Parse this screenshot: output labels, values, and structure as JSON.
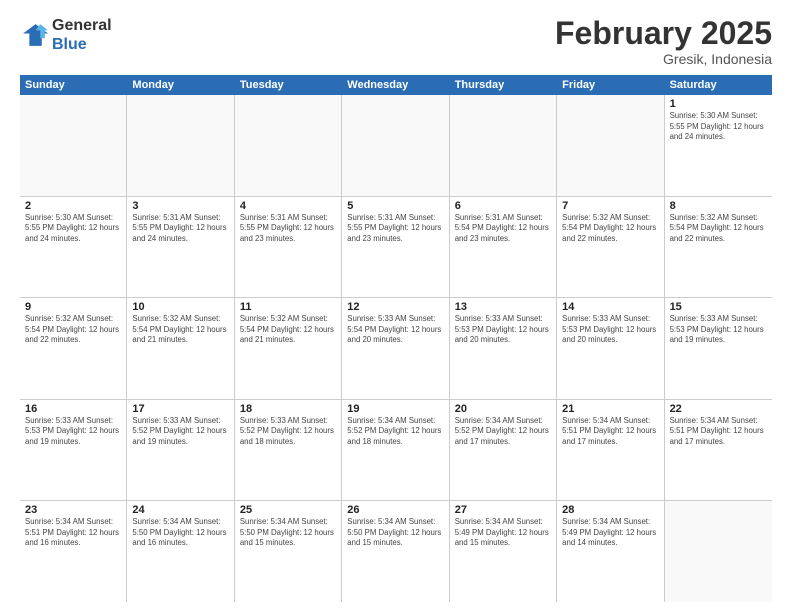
{
  "logo": {
    "line1": "General",
    "line2": "Blue"
  },
  "title": "February 2025",
  "location": "Gresik, Indonesia",
  "days_of_week": [
    "Sunday",
    "Monday",
    "Tuesday",
    "Wednesday",
    "Thursday",
    "Friday",
    "Saturday"
  ],
  "weeks": [
    [
      {
        "day": "",
        "info": "",
        "empty": true
      },
      {
        "day": "",
        "info": "",
        "empty": true
      },
      {
        "day": "",
        "info": "",
        "empty": true
      },
      {
        "day": "",
        "info": "",
        "empty": true
      },
      {
        "day": "",
        "info": "",
        "empty": true
      },
      {
        "day": "",
        "info": "",
        "empty": true
      },
      {
        "day": "1",
        "info": "Sunrise: 5:30 AM\nSunset: 5:55 PM\nDaylight: 12 hours\nand 24 minutes.",
        "empty": false
      }
    ],
    [
      {
        "day": "2",
        "info": "Sunrise: 5:30 AM\nSunset: 5:55 PM\nDaylight: 12 hours\nand 24 minutes.",
        "empty": false
      },
      {
        "day": "3",
        "info": "Sunrise: 5:31 AM\nSunset: 5:55 PM\nDaylight: 12 hours\nand 24 minutes.",
        "empty": false
      },
      {
        "day": "4",
        "info": "Sunrise: 5:31 AM\nSunset: 5:55 PM\nDaylight: 12 hours\nand 23 minutes.",
        "empty": false
      },
      {
        "day": "5",
        "info": "Sunrise: 5:31 AM\nSunset: 5:55 PM\nDaylight: 12 hours\nand 23 minutes.",
        "empty": false
      },
      {
        "day": "6",
        "info": "Sunrise: 5:31 AM\nSunset: 5:54 PM\nDaylight: 12 hours\nand 23 minutes.",
        "empty": false
      },
      {
        "day": "7",
        "info": "Sunrise: 5:32 AM\nSunset: 5:54 PM\nDaylight: 12 hours\nand 22 minutes.",
        "empty": false
      },
      {
        "day": "8",
        "info": "Sunrise: 5:32 AM\nSunset: 5:54 PM\nDaylight: 12 hours\nand 22 minutes.",
        "empty": false
      }
    ],
    [
      {
        "day": "9",
        "info": "Sunrise: 5:32 AM\nSunset: 5:54 PM\nDaylight: 12 hours\nand 22 minutes.",
        "empty": false
      },
      {
        "day": "10",
        "info": "Sunrise: 5:32 AM\nSunset: 5:54 PM\nDaylight: 12 hours\nand 21 minutes.",
        "empty": false
      },
      {
        "day": "11",
        "info": "Sunrise: 5:32 AM\nSunset: 5:54 PM\nDaylight: 12 hours\nand 21 minutes.",
        "empty": false
      },
      {
        "day": "12",
        "info": "Sunrise: 5:33 AM\nSunset: 5:54 PM\nDaylight: 12 hours\nand 20 minutes.",
        "empty": false
      },
      {
        "day": "13",
        "info": "Sunrise: 5:33 AM\nSunset: 5:53 PM\nDaylight: 12 hours\nand 20 minutes.",
        "empty": false
      },
      {
        "day": "14",
        "info": "Sunrise: 5:33 AM\nSunset: 5:53 PM\nDaylight: 12 hours\nand 20 minutes.",
        "empty": false
      },
      {
        "day": "15",
        "info": "Sunrise: 5:33 AM\nSunset: 5:53 PM\nDaylight: 12 hours\nand 19 minutes.",
        "empty": false
      }
    ],
    [
      {
        "day": "16",
        "info": "Sunrise: 5:33 AM\nSunset: 5:53 PM\nDaylight: 12 hours\nand 19 minutes.",
        "empty": false
      },
      {
        "day": "17",
        "info": "Sunrise: 5:33 AM\nSunset: 5:52 PM\nDaylight: 12 hours\nand 19 minutes.",
        "empty": false
      },
      {
        "day": "18",
        "info": "Sunrise: 5:33 AM\nSunset: 5:52 PM\nDaylight: 12 hours\nand 18 minutes.",
        "empty": false
      },
      {
        "day": "19",
        "info": "Sunrise: 5:34 AM\nSunset: 5:52 PM\nDaylight: 12 hours\nand 18 minutes.",
        "empty": false
      },
      {
        "day": "20",
        "info": "Sunrise: 5:34 AM\nSunset: 5:52 PM\nDaylight: 12 hours\nand 17 minutes.",
        "empty": false
      },
      {
        "day": "21",
        "info": "Sunrise: 5:34 AM\nSunset: 5:51 PM\nDaylight: 12 hours\nand 17 minutes.",
        "empty": false
      },
      {
        "day": "22",
        "info": "Sunrise: 5:34 AM\nSunset: 5:51 PM\nDaylight: 12 hours\nand 17 minutes.",
        "empty": false
      }
    ],
    [
      {
        "day": "23",
        "info": "Sunrise: 5:34 AM\nSunset: 5:51 PM\nDaylight: 12 hours\nand 16 minutes.",
        "empty": false
      },
      {
        "day": "24",
        "info": "Sunrise: 5:34 AM\nSunset: 5:50 PM\nDaylight: 12 hours\nand 16 minutes.",
        "empty": false
      },
      {
        "day": "25",
        "info": "Sunrise: 5:34 AM\nSunset: 5:50 PM\nDaylight: 12 hours\nand 15 minutes.",
        "empty": false
      },
      {
        "day": "26",
        "info": "Sunrise: 5:34 AM\nSunset: 5:50 PM\nDaylight: 12 hours\nand 15 minutes.",
        "empty": false
      },
      {
        "day": "27",
        "info": "Sunrise: 5:34 AM\nSunset: 5:49 PM\nDaylight: 12 hours\nand 15 minutes.",
        "empty": false
      },
      {
        "day": "28",
        "info": "Sunrise: 5:34 AM\nSunset: 5:49 PM\nDaylight: 12 hours\nand 14 minutes.",
        "empty": false
      },
      {
        "day": "",
        "info": "",
        "empty": true
      }
    ]
  ]
}
